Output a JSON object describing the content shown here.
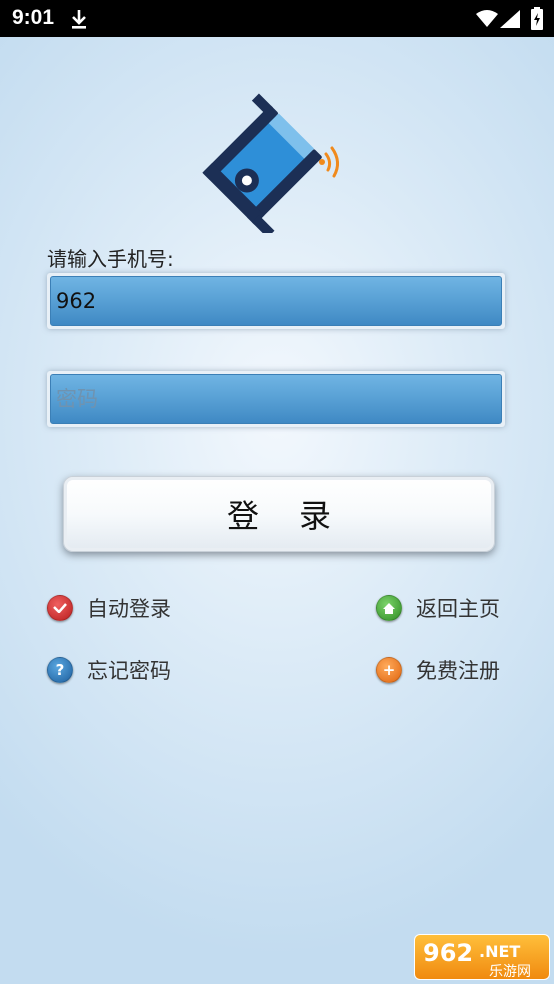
{
  "status_bar": {
    "time": "9:01",
    "icons": [
      "download-icon",
      "wifi-icon",
      "signal-icon",
      "battery-icon"
    ]
  },
  "logo": {
    "icon": "router-wifi-logo"
  },
  "phone": {
    "label": "请输入手机号:",
    "value": "962"
  },
  "password": {
    "placeholder": "密码",
    "value": ""
  },
  "login_button": {
    "label": "登录"
  },
  "options": {
    "auto_login": {
      "label": "自动登录",
      "icon": "checkmark-icon"
    },
    "go_home": {
      "label": "返回主页",
      "icon": "home-icon"
    },
    "forgot_password": {
      "label": "忘记密码",
      "icon": "question-icon",
      "glyph": "?"
    },
    "register": {
      "label": "免费注册",
      "icon": "plus-icon",
      "glyph": "+"
    }
  },
  "watermark": {
    "text_top": "962.NET",
    "text_bottom": "乐游网"
  },
  "colors": {
    "field_blue": "#5aa2d6",
    "logo_navy": "#1c2f55",
    "logo_blue": "#2e8fd8",
    "wifi_orange": "#f08a1c"
  }
}
